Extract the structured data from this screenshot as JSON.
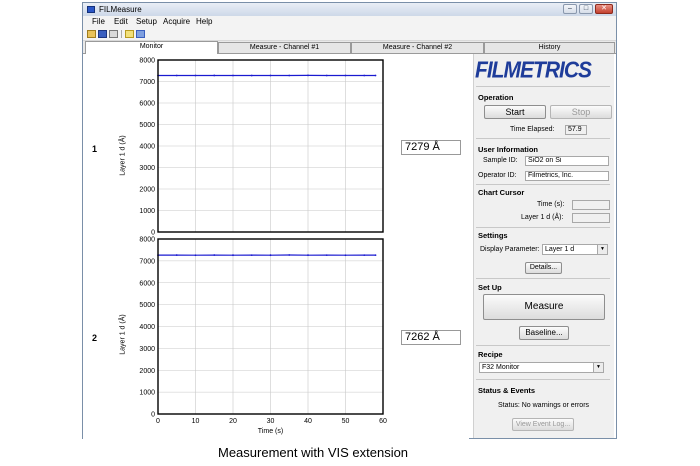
{
  "window": {
    "title": "FILMeasure"
  },
  "menu": [
    "File",
    "Edit",
    "Setup",
    "Acquire",
    "Help"
  ],
  "toolbar_icons": [
    "open-folder-icon",
    "save-icon",
    "print-icon",
    "recipe-icon",
    "copy-icon"
  ],
  "tabs": [
    "Monitor",
    "Measure - Channel #1",
    "Measure - Channel #2",
    "History"
  ],
  "active_tab": "Monitor",
  "readouts": [
    {
      "index": "1",
      "value": "7279 Å"
    },
    {
      "index": "2",
      "value": "7262 Å"
    }
  ],
  "sidebar": {
    "logo": "FILMETRICS",
    "operation": {
      "title": "Operation",
      "start": "Start",
      "stop": "Stop",
      "time_label": "Time Elapsed:",
      "time_value": "57.9"
    },
    "user": {
      "title": "User Information",
      "sample_label": "Sample ID:",
      "sample_value": "SiO2 on Si",
      "operator_label": "Operator ID:",
      "operator_value": "Filmetrics, Inc."
    },
    "cursor": {
      "title": "Chart Cursor",
      "time_label": "Time (s):",
      "layer_label": "Layer 1 d (Å):"
    },
    "settings": {
      "title": "Settings",
      "param_label": "Display Parameter:",
      "param_value": "Layer 1 d",
      "details": "Details..."
    },
    "setup": {
      "title": "Set Up",
      "measure": "Measure",
      "baseline": "Baseline..."
    },
    "recipe": {
      "title": "Recipe",
      "value": "F32 Monitor"
    },
    "status": {
      "title": "Status & Events",
      "text": "Status: No warnings or errors",
      "log": "View Event Log..."
    }
  },
  "caption": "Measurement with VIS extension",
  "colors": {
    "series": "#1a1ad0",
    "accent": "#1e3c9a"
  },
  "chart_data": [
    {
      "type": "line",
      "ylabel": "Layer 1 d (Å)",
      "xlabel": "",
      "xlim": [
        0,
        60
      ],
      "ylim": [
        0,
        8000
      ],
      "xticks": [],
      "yticks": [
        0,
        1000,
        2000,
        3000,
        4000,
        5000,
        6000,
        7000,
        8000
      ],
      "grid": true,
      "series": [
        {
          "x": [
            0,
            5,
            10,
            15,
            20,
            25,
            30,
            35,
            40,
            45,
            50,
            55,
            58
          ],
          "values": [
            7279,
            7280,
            7278,
            7281,
            7279,
            7277,
            7280,
            7279,
            7282,
            7278,
            7280,
            7279,
            7279
          ]
        }
      ]
    },
    {
      "type": "line",
      "ylabel": "Layer 1 d (Å)",
      "xlabel": "Time (s)",
      "xlim": [
        0,
        60
      ],
      "ylim": [
        0,
        8000
      ],
      "xticks": [
        0,
        10,
        20,
        30,
        40,
        50,
        60
      ],
      "yticks": [
        0,
        1000,
        2000,
        3000,
        4000,
        5000,
        6000,
        7000,
        8000
      ],
      "grid": true,
      "series": [
        {
          "x": [
            0,
            5,
            10,
            15,
            20,
            25,
            30,
            35,
            40,
            45,
            50,
            55,
            58
          ],
          "values": [
            7262,
            7265,
            7258,
            7266,
            7260,
            7263,
            7259,
            7267,
            7261,
            7264,
            7258,
            7263,
            7262
          ]
        }
      ]
    }
  ]
}
